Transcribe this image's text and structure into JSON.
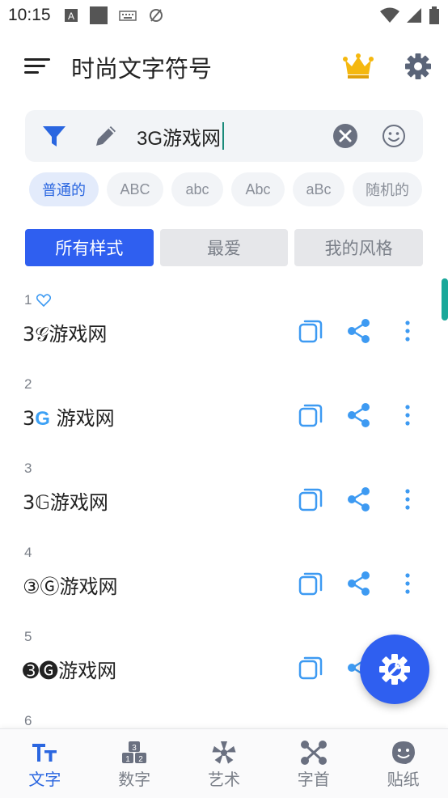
{
  "status_bar": {
    "time": "10:15",
    "icons_left": [
      "a-letter-icon",
      "square-icon",
      "keyboard-icon",
      "no-sync-icon"
    ],
    "icons_right": [
      "wifi-icon",
      "signal-icon",
      "battery-icon"
    ]
  },
  "app_bar": {
    "title": "时尚文字符号",
    "crown_color": "#f5b80f",
    "gear_color": "#5a6478"
  },
  "input": {
    "value": "3G游戏网",
    "icons": [
      "filter-icon",
      "pencil-icon",
      "clear-icon",
      "emoji-icon"
    ]
  },
  "chips": [
    {
      "label": "普通的",
      "active": true
    },
    {
      "label": "ABC",
      "active": false
    },
    {
      "label": "abc",
      "active": false
    },
    {
      "label": "Abc",
      "active": false
    },
    {
      "label": "aBc",
      "active": false
    },
    {
      "label": "随机的",
      "active": false
    }
  ],
  "tabs": [
    {
      "label": "所有样式",
      "active": true
    },
    {
      "label": "最爱",
      "active": false
    },
    {
      "label": "我的风格",
      "active": false
    }
  ],
  "rows": [
    {
      "num": "1",
      "text": "3𝒢游戏网",
      "favorite": true
    },
    {
      "num": "2",
      "text_prefix": "3",
      "text_g": "G",
      "text_suffix": " 游戏网",
      "favorite": false
    },
    {
      "num": "3",
      "text": "3𝔾游戏网",
      "favorite": false
    },
    {
      "num": "4",
      "text": "③Ⓖ游戏网",
      "favorite": false
    },
    {
      "num": "5",
      "text": "➌🅖游戏网",
      "favorite": false
    },
    {
      "num": "6",
      "text": "",
      "favorite": false
    }
  ],
  "bottom_nav": [
    {
      "label": "文字",
      "icon": "text-icon",
      "active": true
    },
    {
      "label": "数字",
      "icon": "numbers-icon",
      "active": false
    },
    {
      "label": "艺术",
      "icon": "art-icon",
      "active": false
    },
    {
      "label": "字首",
      "icon": "prefix-icon",
      "active": false
    },
    {
      "label": "贴纸",
      "icon": "sticker-icon",
      "active": false
    }
  ],
  "colors": {
    "accent": "#2f5ff0",
    "action_icon": "#3d9af2",
    "scroll_thumb": "#1aa89a"
  }
}
